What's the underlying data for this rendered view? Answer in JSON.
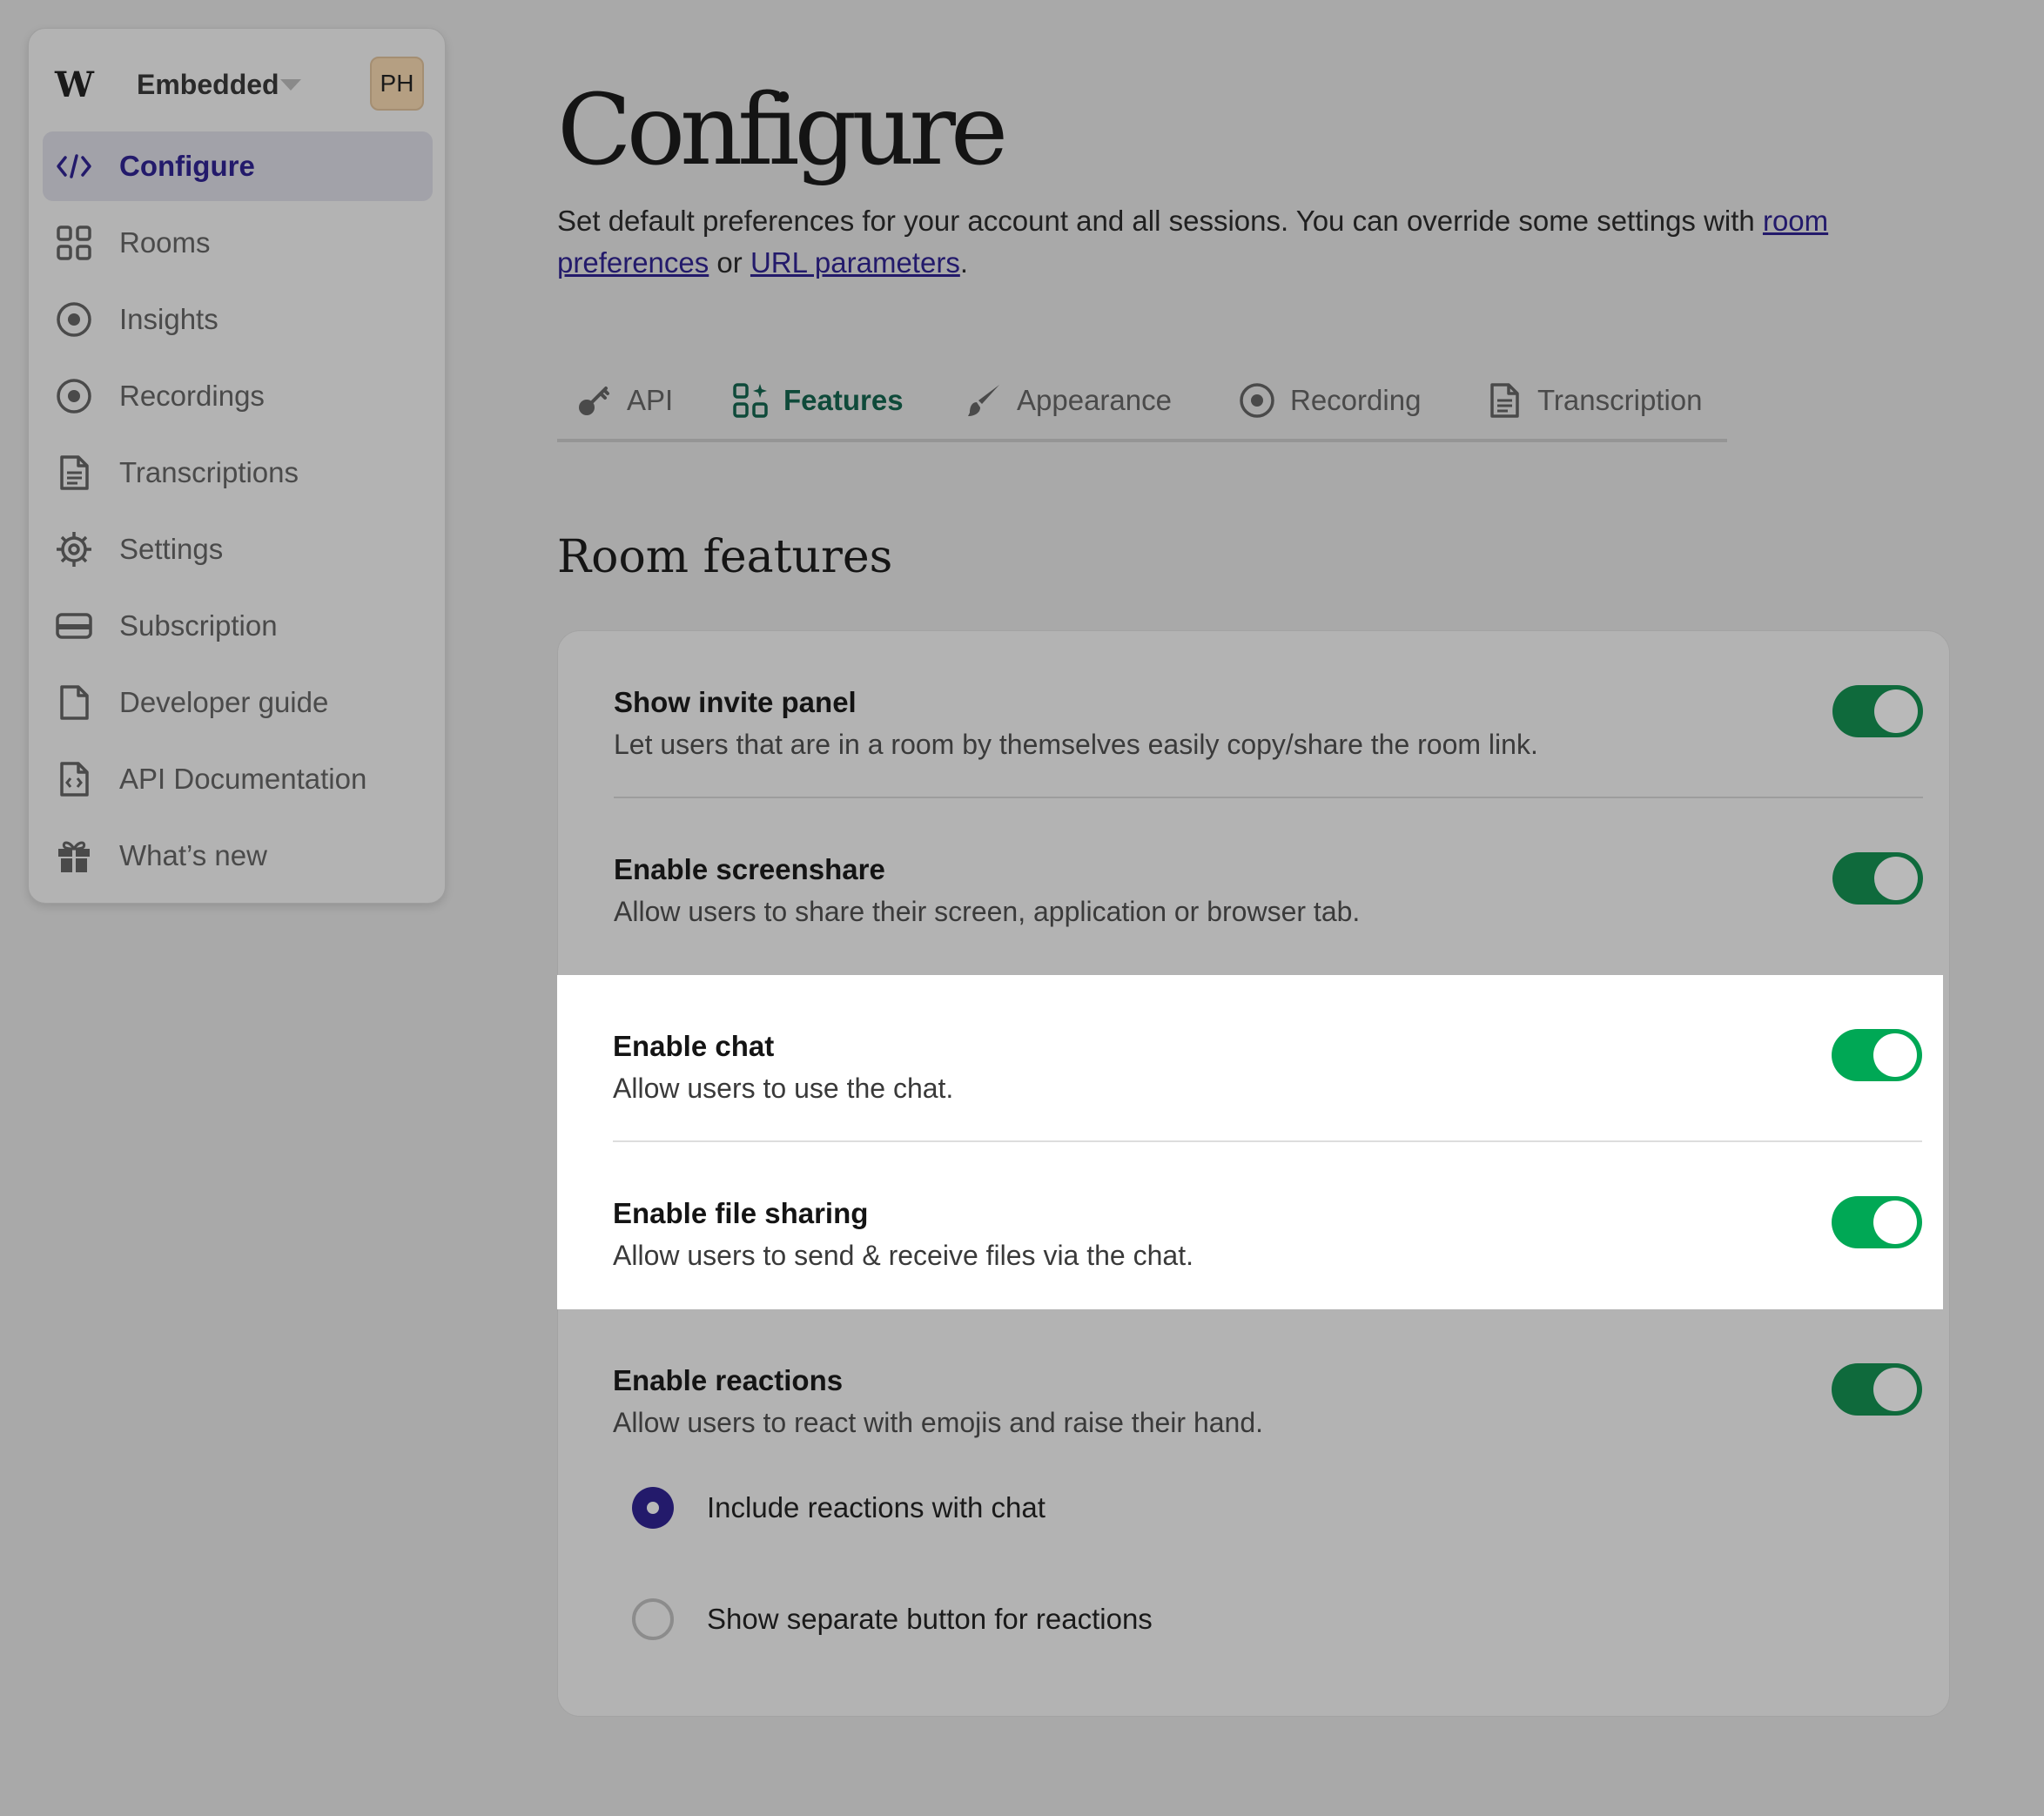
{
  "sidebar": {
    "org_name": "Embedded",
    "avatar_initials": "PH",
    "items": [
      {
        "label": "Configure",
        "icon": "code-brackets-icon",
        "active": true
      },
      {
        "label": "Rooms",
        "icon": "grid-icon"
      },
      {
        "label": "Insights",
        "icon": "target-icon"
      },
      {
        "label": "Recordings",
        "icon": "record-icon"
      },
      {
        "label": "Transcriptions",
        "icon": "document-lines-icon"
      },
      {
        "label": "Settings",
        "icon": "gear-icon"
      },
      {
        "label": "Subscription",
        "icon": "credit-card-icon"
      },
      {
        "label": "Developer guide",
        "icon": "file-icon"
      },
      {
        "label": "API Documentation",
        "icon": "code-file-icon"
      },
      {
        "label": "What’s new",
        "icon": "gift-icon"
      }
    ]
  },
  "main": {
    "title": "Configure",
    "intro": {
      "text_before": "Set default preferences for your account and all sessions. You can override some settings with ",
      "link1": "room preferences",
      "text_middle": " or ",
      "link2": "URL parameters",
      "text_after": "."
    },
    "tabs": [
      {
        "label": "API",
        "icon": "key-icon"
      },
      {
        "label": "Features",
        "icon": "grid-sparkle-icon",
        "active": true
      },
      {
        "label": "Appearance",
        "icon": "paintbrush-icon"
      },
      {
        "label": "Recording",
        "icon": "record-icon"
      },
      {
        "label": "Transcription",
        "icon": "document-lines-icon"
      }
    ],
    "section_title": "Room features",
    "features": [
      {
        "title": "Show invite panel",
        "description": "Let users that are in a room by themselves easily copy/share the room link.",
        "enabled": true
      },
      {
        "title": "Enable screenshare",
        "description": "Allow users to share their screen, application or browser tab.",
        "enabled": true
      },
      {
        "title": "Enable chat",
        "description": "Allow users to use the chat.",
        "enabled": true
      },
      {
        "title": "Enable file sharing",
        "description": "Allow users to send & receive files via the chat.",
        "enabled": true
      },
      {
        "title": "Enable reactions",
        "description": "Allow users to react with emojis and raise their hand.",
        "enabled": true
      }
    ],
    "reaction_options": [
      {
        "label": "Include reactions with chat",
        "selected": true
      },
      {
        "label": "Show separate button for reactions",
        "selected": false
      }
    ]
  },
  "colors": {
    "overlay_gray": "#a9a9a9",
    "brand_indigo": "#231a6b",
    "toggle_green": "#00a855",
    "active_tab_green": "#0f4a3a"
  }
}
